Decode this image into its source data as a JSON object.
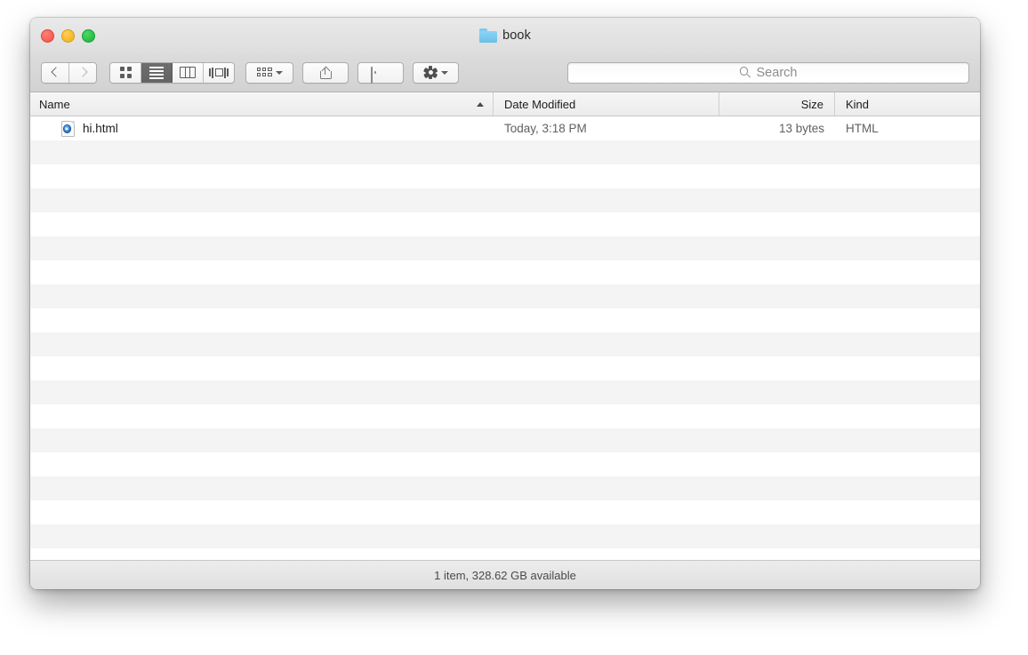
{
  "window": {
    "title": "book",
    "title_icon": "folder-icon",
    "traffic_lights": {
      "close_label": "Close",
      "minimize_label": "Minimize",
      "zoom_label": "Zoom"
    }
  },
  "toolbar": {
    "back_label": "Back",
    "forward_label": "Forward",
    "view_icon": "icon-view",
    "view_list": "list-view",
    "view_column": "column-view",
    "view_coverflow": "coverflow-view",
    "arrange_label": "Arrange",
    "share_label": "Share",
    "tag_label": "Edit Tags",
    "action_label": "Action"
  },
  "search": {
    "placeholder": "Search",
    "value": "",
    "icon": "search-icon"
  },
  "columns": [
    {
      "id": "name",
      "label": "Name",
      "sorted": true,
      "sort_direction": "ascending"
    },
    {
      "id": "date",
      "label": "Date Modified",
      "sorted": false
    },
    {
      "id": "size",
      "label": "Size",
      "sorted": false
    },
    {
      "id": "kind",
      "label": "Kind",
      "sorted": false
    }
  ],
  "files": [
    {
      "name": "hi.html",
      "date_modified": "Today, 3:18 PM",
      "size": "13 bytes",
      "kind": "HTML",
      "icon": "html-document-icon"
    }
  ],
  "empty_row_count": 17,
  "status": {
    "text": "1 item, 328.62 GB available"
  },
  "colors": {
    "window_chrome": "#dcdcdc",
    "stripe": "#f4f4f4",
    "selected_view_button": "#6e6e6e",
    "folder_blue": "#68c0ea",
    "text_primary": "#1a1a1a",
    "text_secondary": "#606060"
  }
}
